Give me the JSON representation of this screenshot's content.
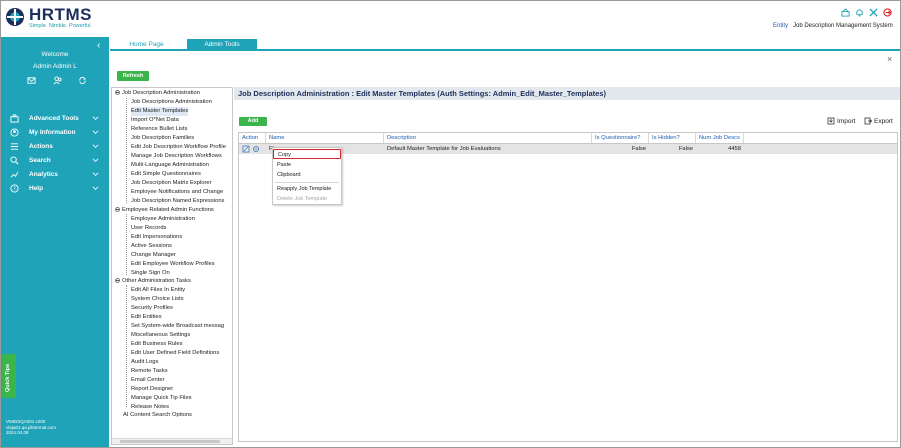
{
  "app": {
    "logo_text": "HRTMS",
    "tagline": "Simple. Nimble. Powerful.",
    "entity_label": "Entity",
    "entity_name": "Job Description Management System"
  },
  "header_icons": [
    "admin-icon",
    "bell-icon",
    "puzzle-icon",
    "logout-icon"
  ],
  "sidebar": {
    "welcome": "Welcome",
    "user_name": "Admin Admin L",
    "nav": [
      {
        "label": "Advanced Tools",
        "icon": "briefcase-icon"
      },
      {
        "label": "My Information",
        "icon": "user-icon"
      },
      {
        "label": "Actions",
        "icon": "list-icon"
      },
      {
        "label": "Search",
        "icon": "search-icon"
      },
      {
        "label": "Analytics",
        "icon": "chart-icon"
      },
      {
        "label": "Help",
        "icon": "help-icon"
      }
    ],
    "quick_tips": "Quick Tips",
    "footer_line1": "VMIDSQA001 v200",
    "footer_line2": "vtiqa01.qa.jdinternal.com",
    "footer_line3": "2024.04.08"
  },
  "tabs": {
    "home": "Home Page",
    "admin": "Admin Tools"
  },
  "toolbar": {
    "refresh": "Refresh",
    "add": "Add",
    "import": "Import",
    "export": "Export"
  },
  "panel": {
    "title": "Job Description Administration : Edit Master Templates (Auth Settings: Admin_Edit_Master_Templates)"
  },
  "tree": {
    "groups": [
      {
        "label": "Job Description Administration",
        "items": [
          "Job Descriptions Administration",
          "Edit Master Templates",
          "Import O*Net Data",
          "Reference Bullet Lists",
          "Job Description Families",
          "Edit Job Description Workflow Profile",
          "Manage Job Description Workflows",
          "Multi-Language Administration",
          "Edit Simple Questionnaires",
          "Job Description Matrix Explorer",
          "Employee Notifications and Change",
          "Job Description Named Expressions"
        ]
      },
      {
        "label": "Employee Related Admin Functions",
        "items": [
          "Employee Administration",
          "User Records",
          "Edit Impersonations",
          "Active Sessions",
          "Change Manager",
          "Edit Employee Workflow Profiles",
          "Single Sign On"
        ]
      },
      {
        "label": "Other Administration Tasks",
        "items": [
          "Edit All Files In Entity",
          "System Choice Lists",
          "Security Profiles",
          "Edit Entities",
          "Set System-wide Broadcast messag",
          "Miscellaneous Settings",
          "Edit Business Rules",
          "Edit User Defined Field Definitions",
          "Audit Logs",
          "Remote Tasks",
          "Email Center",
          "Report Designer",
          "Manage Quick Tip Files",
          "Release Notes"
        ]
      }
    ],
    "last_item": "AI Content Search Options",
    "selected": "Edit Master Templates"
  },
  "grid": {
    "columns": [
      "Action",
      "Name",
      "Description",
      "Is Questionnaire?",
      "Is Hidden?",
      "Num Job Descs"
    ],
    "rows": [
      {
        "name": "Fl",
        "description": "Default Master Template for Job Evaluations",
        "is_questionnaire": "False",
        "is_hidden": "False",
        "num_job_descs": "4458"
      }
    ]
  },
  "context_menu": {
    "items": [
      "Copy",
      "Paste",
      "Clipboard",
      "Reapply Job Template",
      "Delete Job Template"
    ],
    "hovered": "Copy",
    "disabled": "Delete Job Template"
  },
  "colors": {
    "teal": "#1fa3b8",
    "green": "#3bb54a",
    "navy": "#1c2f5a",
    "highlight_red": "#d8262a"
  }
}
